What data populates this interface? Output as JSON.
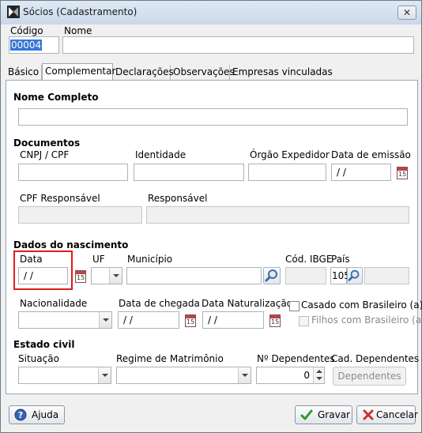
{
  "window": {
    "title": "Sócios (Cadastramento)",
    "close_glyph": "✕"
  },
  "header": {
    "codigo_label": "Código",
    "codigo_value": "00004",
    "nome_label": "Nome",
    "nome_value": ""
  },
  "tabs": [
    {
      "label": "Básico"
    },
    {
      "label": "Complementar"
    },
    {
      "label": "Declarações"
    },
    {
      "label": "Observações"
    },
    {
      "label": "Empresas vinculadas"
    }
  ],
  "nome_completo": {
    "label": "Nome Completo",
    "value": ""
  },
  "documentos": {
    "section_label": "Documentos",
    "cnpj_label": "CNPJ / CPF",
    "identidade_label": "Identidade",
    "orgao_label": "Órgão Expedidor",
    "data_emissao_label": "Data de emissão",
    "data_emissao_value": " / /",
    "cpf_resp_label": "CPF Responsável",
    "responsavel_label": "Responsável",
    "calendar_glyph": "15"
  },
  "nascimento": {
    "section_label": "Dados do nascimento",
    "data_label": "Data",
    "data_value": " / /",
    "uf_label": "UF",
    "municipio_label": "Município",
    "cod_ibge_label": "Cód. IBGE",
    "pais_label": "País",
    "pais_value": "105",
    "nacionalidade_label": "Nacionalidade",
    "data_chegada_label": "Data de chegada",
    "data_chegada_value": " / /",
    "data_naturalizacao_label": "Data Naturalização",
    "data_naturalizacao_value": " / /",
    "casado_label": "Casado com Brasileiro (a)",
    "filhos_label": "Filhos com Brasileiro (a)",
    "casado_checked": false,
    "filhos_checked": false
  },
  "estado_civil": {
    "section_label": "Estado civil",
    "situacao_label": "Situação",
    "regime_label": "Regime de Matrimônio",
    "num_dependentes_label": "Nº Dependentes",
    "num_dependentes_value": "0",
    "cad_dependentes_label": "Cad. Dependentes",
    "dependentes_button": "Dependentes"
  },
  "footer": {
    "ajuda": "Ajuda",
    "gravar": "Gravar",
    "cancelar": "Cancelar"
  },
  "colors": {
    "highlight": "#e01b1b",
    "selection": "#3875d7",
    "ok_green": "#2f9a2f",
    "cancel_red": "#d03030"
  },
  "icons": {
    "app": "app-logo-icon",
    "calendar": "calendar-icon",
    "search": "magnifier-icon",
    "help": "help-icon",
    "save": "checkmark-icon",
    "cancel": "x-icon"
  }
}
